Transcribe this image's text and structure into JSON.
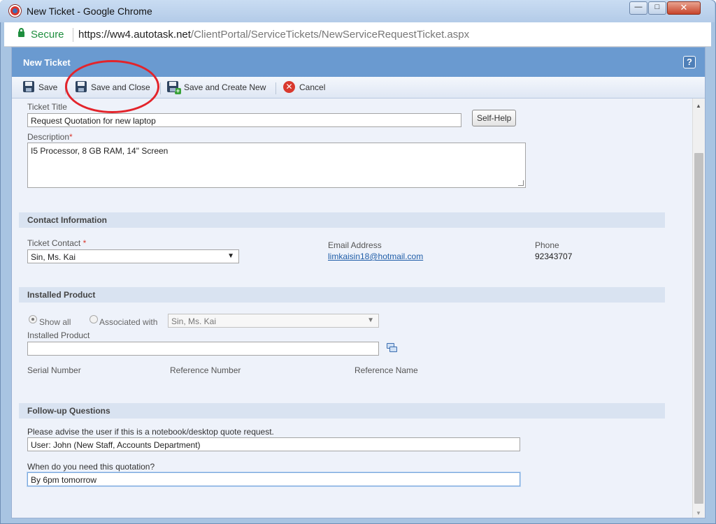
{
  "window": {
    "title": "New Ticket - Google Chrome",
    "minimize_glyph": "—",
    "maximize_glyph": "□",
    "close_glyph": "✕"
  },
  "address_bar": {
    "secure_label": "Secure",
    "url_host": "https://ww4.autotask.net",
    "url_path": "/ClientPortal/ServiceTickets/NewServiceRequestTicket.aspx"
  },
  "page": {
    "title": "New Ticket",
    "help_label": "?"
  },
  "toolbar": {
    "save_label": "Save",
    "save_close_label": "Save and Close",
    "save_new_label": "Save and Create New",
    "cancel_label": "Cancel",
    "cancel_glyph": "✕",
    "plus_glyph": "+"
  },
  "form": {
    "ticket_title_label": "Ticket Title",
    "ticket_title_value": "Request Quotation for new laptop",
    "self_help_label": "Self-Help",
    "description_label": "Description",
    "description_value": "I5 Processor, 8 GB RAM, 14\" Screen",
    "required_mark": "*"
  },
  "contact": {
    "header": "Contact Information",
    "ticket_contact_label": "Ticket Contact",
    "ticket_contact_value": "Sin, Ms. Kai",
    "email_label": "Email Address",
    "email_value": "limkaisin18@hotmail.com",
    "phone_label": "Phone",
    "phone_value": "92343707"
  },
  "installed_product": {
    "header": "Installed Product",
    "show_all_label": "Show all",
    "associated_with_label": "Associated with",
    "associated_value": "Sin, Ms. Kai",
    "installed_product_label": "Installed Product",
    "installed_product_value": "",
    "serial_number_label": "Serial Number",
    "reference_number_label": "Reference Number",
    "reference_name_label": "Reference Name"
  },
  "followup": {
    "header": "Follow-up Questions",
    "q1_label": "Please advise the user if this is a notebook/desktop quote request.",
    "q1_value": "User: John (New Staff, Accounts Department)",
    "q2_label": "When do you need this quotation?",
    "q2_value": "By 6pm tomorrow"
  },
  "icons": {
    "dropdown_arrow": "▼",
    "scroll_up": "▲",
    "scroll_down": "▼"
  },
  "colors": {
    "header_blue": "#6a9ad0",
    "annotation_red": "#e3242b",
    "link_blue": "#1f5da8",
    "secure_green": "#1e8e3e"
  }
}
